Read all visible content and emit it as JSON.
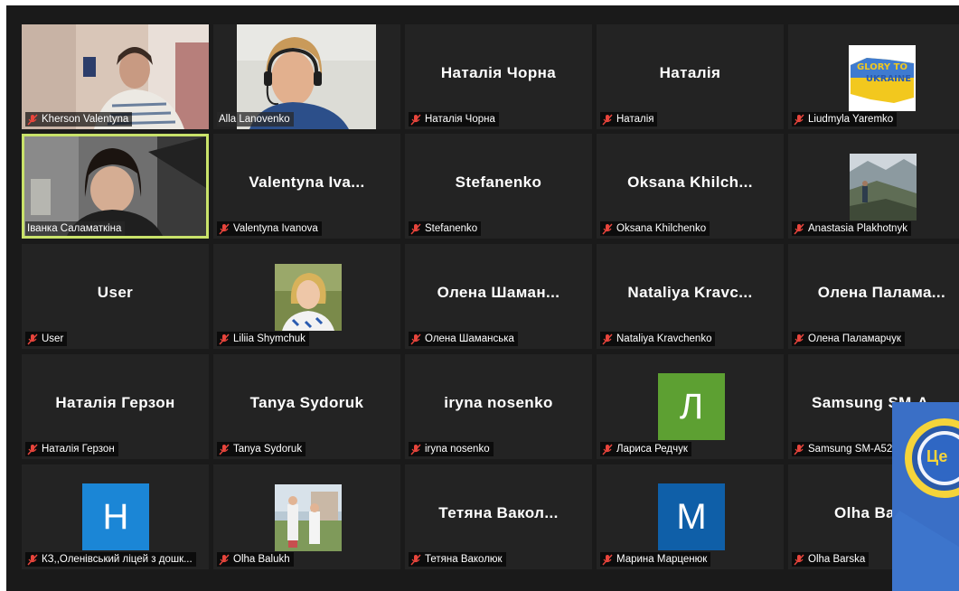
{
  "participants": [
    {
      "label": "Kherson Valentyna",
      "type": "video"
    },
    {
      "label": "Alla Lanovenko",
      "type": "video"
    },
    {
      "name": "Наталія Чорна",
      "label": "Наталія Чорна",
      "type": "name"
    },
    {
      "name": "Наталія",
      "label": "Наталія",
      "type": "name"
    },
    {
      "label": "Liudmyla Yaremko",
      "type": "image",
      "image_text_1": "GLORY TO",
      "image_text_2": "UKRAINE"
    },
    {
      "label": "Іванка Саламаткіна",
      "type": "video"
    },
    {
      "name": "Valentyna Iva...",
      "label": "Valentyna Ivanova",
      "type": "name"
    },
    {
      "name": "Stefanenko",
      "label": "Stefanenko",
      "type": "name"
    },
    {
      "name": "Oksana Khilch...",
      "label": "Oksana Khilchenko",
      "type": "name"
    },
    {
      "label": "Anastasia Plakhotnyk",
      "type": "image"
    },
    {
      "name": "User",
      "label": "User",
      "type": "name"
    },
    {
      "label": "Liliia Shymchuk",
      "type": "image"
    },
    {
      "name": "Олена Шаман...",
      "label": "Олена Шаманська",
      "type": "name"
    },
    {
      "name": "Nataliya Kravc...",
      "label": "Nataliya Kravchenko",
      "type": "name"
    },
    {
      "name": "Олена Палама...",
      "label": "Олена Паламарчук",
      "type": "name"
    },
    {
      "name": "Наталія Герзон",
      "label": "Наталія Герзон",
      "type": "name"
    },
    {
      "name": "Tanya Sydoruk",
      "label": "Tanya Sydoruk",
      "type": "name"
    },
    {
      "name": "iryna nosenko",
      "label": "iryna nosenko",
      "type": "name"
    },
    {
      "label": "Лариса Редчук",
      "type": "letter",
      "letter": "Л",
      "color": "#5da032"
    },
    {
      "name": "Samsung SM-A...",
      "label": "Samsung SM-A52",
      "type": "name"
    },
    {
      "label": "КЗ,,Оленівський ліцей з дошк...",
      "type": "letter",
      "letter": "Н",
      "color": "#1b86d6"
    },
    {
      "label": "Olha Balukh",
      "type": "image"
    },
    {
      "name": "Тетяна Вакол...",
      "label": "Тетяна Ваколюк",
      "type": "name"
    },
    {
      "label": "Марина Марценюк",
      "type": "letter",
      "letter": "М",
      "color": "#0f5fa8"
    },
    {
      "name": "Olha Ba...",
      "label": "Olha Barska",
      "type": "name"
    }
  ],
  "overlay": {
    "logo_text": "Це"
  },
  "colors": {
    "active_border": "#c9e26a",
    "mute_icon": "#e8453c",
    "tile_bg": "#232323",
    "gallery_bg": "#1a1a1a"
  }
}
